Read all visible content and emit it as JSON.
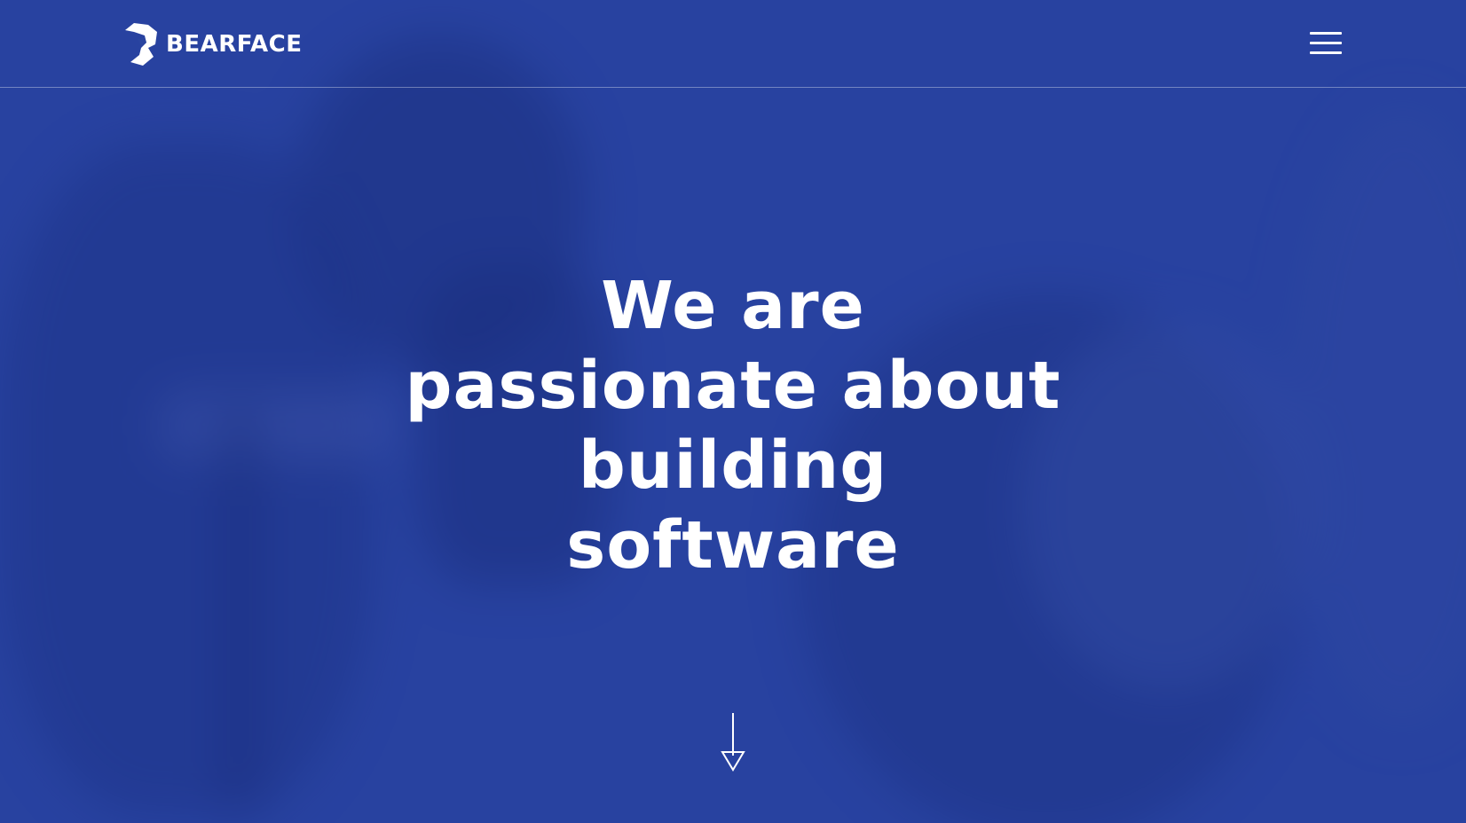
{
  "header": {
    "brand": "BEARFACE",
    "menu_icon": "hamburger-menu-icon"
  },
  "hero": {
    "headline_lines": [
      "We are",
      "passionate about",
      "building",
      "software"
    ],
    "scroll_icon": "arrow-down-icon"
  },
  "colors": {
    "overlay": "#2a45a0",
    "text": "#ffffff"
  }
}
